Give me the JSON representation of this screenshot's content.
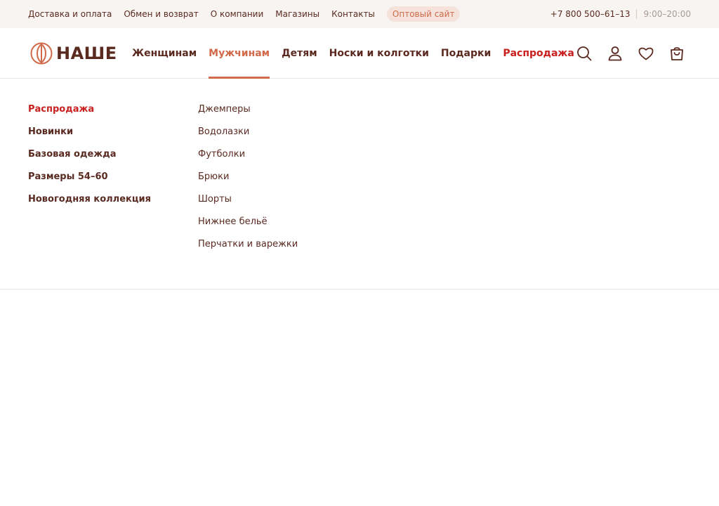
{
  "topbar": {
    "links": [
      "Доставка и оплата",
      "Обмен и возврат",
      "О компании",
      "Магазины",
      "Контакты"
    ],
    "wholesale": "Оптовый сайт",
    "phone": "+7 800 500–61–13",
    "hours": "9:00–20:00"
  },
  "logo": {
    "text": "НАШЕ"
  },
  "nav": {
    "items": [
      "Женщинам",
      "Мужчинам",
      "Детям",
      "Носки и колготки",
      "Подарки",
      "Распродажа"
    ],
    "active": "Мужчинам"
  },
  "icons": [
    "search-icon",
    "user-icon",
    "heart-icon",
    "cart-icon"
  ],
  "dropdown": {
    "col1": [
      "Распродажа",
      "Новинки",
      "Базовая одежда",
      "Размеры 54–60",
      "Новогодняя коллекция"
    ],
    "col2": [
      "Джемперы",
      "Водолазки",
      "Футболки",
      "Брюки",
      "Шорты",
      "Нижнее бельё",
      "Перчатки и варежки"
    ]
  },
  "colors": {
    "brand": "#5a2a20",
    "accent": "#d06a4a",
    "sale": "#c8201e",
    "topbar_bg": "#f8f4f1"
  }
}
